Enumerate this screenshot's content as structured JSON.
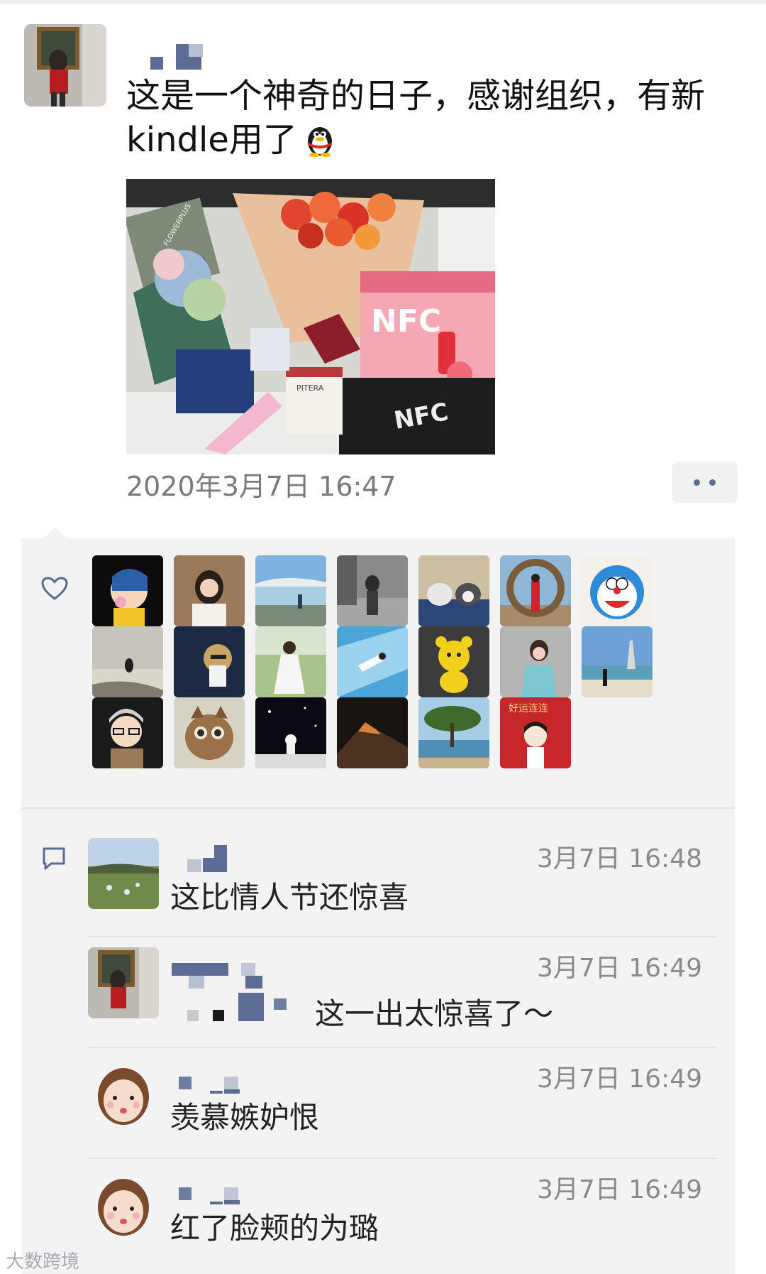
{
  "post": {
    "text": "这是一个神奇的日子，感谢组织，有新kindle用了",
    "time": "2020年3月7日 16:47",
    "photo_labels": {
      "brand_nfc": "NFC",
      "brand_pitera": "PITERA",
      "brand_florist": "FLOWERPLUS"
    }
  },
  "icons": {
    "heart": "heart-icon",
    "comment": "comment-icon",
    "more": "more-dots-icon",
    "emoji": "qq-penguin-icon"
  },
  "likes": {
    "avatar_text": "好运连连"
  },
  "comments": [
    {
      "time": "3月7日 16:48",
      "text": "这比情人节还惊喜"
    },
    {
      "time": "3月7日 16:49",
      "text": "这一出太惊喜了～"
    },
    {
      "time": "3月7日 16:49",
      "text": "羡慕嫉妒恨"
    },
    {
      "time": "3月7日 16:49",
      "text": "红了脸颊的为璐"
    }
  ],
  "watermark": "大数跨境"
}
